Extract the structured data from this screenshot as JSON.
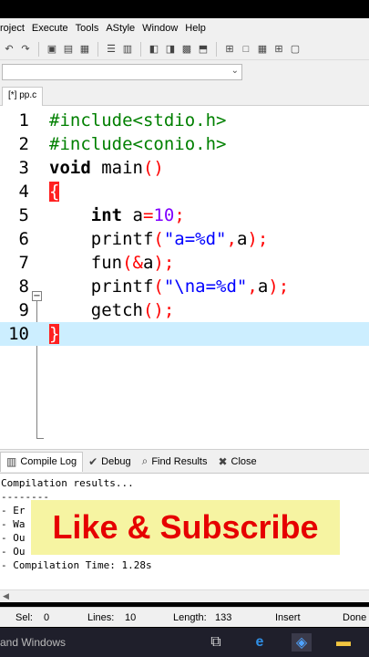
{
  "menu": [
    "roject",
    "Execute",
    "Tools",
    "AStyle",
    "Window",
    "Help"
  ],
  "file_tab": "[*] pp.c",
  "editor": {
    "lines": [
      {
        "n": "1",
        "segments": [
          {
            "t": "#include<stdio.h>",
            "c": "pp"
          }
        ]
      },
      {
        "n": "2",
        "segments": [
          {
            "t": "#include<conio.h>",
            "c": "pp"
          }
        ]
      },
      {
        "n": "3",
        "segments": [
          {
            "t": "void",
            "c": "kw"
          },
          {
            "t": " main",
            "c": ""
          },
          {
            "t": "()",
            "c": "sym"
          }
        ]
      },
      {
        "n": "4",
        "segments": [
          {
            "t": "{",
            "c": "brace"
          }
        ]
      },
      {
        "n": "5",
        "segments": [
          {
            "t": "    ",
            "c": ""
          },
          {
            "t": "int",
            "c": "kw"
          },
          {
            "t": " a",
            "c": ""
          },
          {
            "t": "=",
            "c": "sym"
          },
          {
            "t": "10",
            "c": "num"
          },
          {
            "t": ";",
            "c": "sym"
          }
        ]
      },
      {
        "n": "6",
        "segments": [
          {
            "t": "    printf",
            "c": ""
          },
          {
            "t": "(",
            "c": "sym"
          },
          {
            "t": "\"a=%d\"",
            "c": "str"
          },
          {
            "t": ",",
            "c": "sym"
          },
          {
            "t": "a",
            "c": ""
          },
          {
            "t": ");",
            "c": "sym"
          }
        ]
      },
      {
        "n": "7",
        "segments": [
          {
            "t": "    fun",
            "c": ""
          },
          {
            "t": "(&",
            "c": "sym"
          },
          {
            "t": "a",
            "c": ""
          },
          {
            "t": ");",
            "c": "sym"
          }
        ]
      },
      {
        "n": "8",
        "segments": [
          {
            "t": "    printf",
            "c": ""
          },
          {
            "t": "(",
            "c": "sym"
          },
          {
            "t": "\"\\na=%d\"",
            "c": "str"
          },
          {
            "t": ",",
            "c": "sym"
          },
          {
            "t": "a",
            "c": ""
          },
          {
            "t": ");",
            "c": "sym"
          }
        ]
      },
      {
        "n": "9",
        "segments": [
          {
            "t": "    getch",
            "c": ""
          },
          {
            "t": "();",
            "c": "sym"
          }
        ]
      },
      {
        "n": "10",
        "segments": [
          {
            "t": "}",
            "c": "brace"
          }
        ],
        "current": true
      }
    ]
  },
  "bottom_tabs": [
    {
      "label": "Compile Log",
      "icon": "chart-icon",
      "glyph": "▥",
      "active": true
    },
    {
      "label": "Debug",
      "icon": "check-icon",
      "glyph": "✔"
    },
    {
      "label": "Find Results",
      "icon": "find-icon",
      "glyph": "⌕"
    },
    {
      "label": "Close",
      "icon": "close-icon",
      "glyph": "✖"
    }
  ],
  "log": {
    "lines": [
      "Compilation results...",
      "--------",
      "- Er",
      "- Wa",
      "- Ou",
      "- Ou",
      "- Compilation Time: 1.28s"
    ]
  },
  "overlay_text": "Like & Subscribe",
  "status": {
    "sel_label": "Sel:",
    "sel_value": "0",
    "lines_label": "Lines:",
    "lines_value": "10",
    "length_label": "Length:",
    "length_value": "133",
    "mode": "Insert",
    "state": "Done"
  },
  "taskbar": {
    "text": "and Windows"
  }
}
